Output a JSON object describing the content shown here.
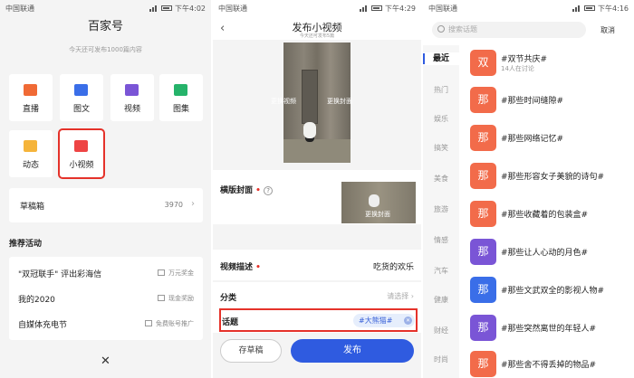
{
  "panel1": {
    "status": {
      "carrier": "中国联通",
      "time": "下午4:02"
    },
    "title": "百家号",
    "subtitle": "今天还可发布1000篇内容",
    "tiles": [
      {
        "label": "直播",
        "icon": "live-camera-icon",
        "color": "#f06a35"
      },
      {
        "label": "图文",
        "icon": "document-icon",
        "color": "#3a6ee8"
      },
      {
        "label": "视频",
        "icon": "video-play-icon",
        "color": "#7a55d6"
      },
      {
        "label": "图集",
        "icon": "image-gallery-icon",
        "color": "#25b36a"
      },
      {
        "label": "动态",
        "icon": "chat-bubble-icon",
        "color": "#f5b43b"
      },
      {
        "label": "小视频",
        "icon": "short-video-icon",
        "color": "#ee4444"
      }
    ],
    "draft": {
      "label": "草稿箱",
      "count": "3970"
    },
    "recommended_title": "推荐活动",
    "activities": [
      {
        "title": "\"双冠联手\" 评出彩海信",
        "tag": "万元奖金"
      },
      {
        "title": "我的2020",
        "tag": "现金奖励"
      },
      {
        "title": "自媒体充电节",
        "tag": "免费账号推广"
      }
    ],
    "close": "✕"
  },
  "panel2": {
    "status": {
      "carrier": "中国联通",
      "time": "下午4:29"
    },
    "title": "发布小视频",
    "subtitle": "今天还可发布5篇",
    "replace_video": "更换视频",
    "replace_cover": "更换封面",
    "cover_label": "横版封面",
    "cover_replace": "更换封面",
    "desc_label": "视频描述",
    "desc_value": "吃货的欢乐",
    "category_label": "分类",
    "category_placeholder": "请选择",
    "topic_label": "话题",
    "topic_tag": "#大熊猫#",
    "save_draft": "存草稿",
    "publish": "发布"
  },
  "panel3": {
    "status": {
      "carrier": "中国联通",
      "time": "下午4:16"
    },
    "search_placeholder": "搜索话题",
    "cancel": "取消",
    "categories": [
      "最近",
      "热门",
      "娱乐",
      "搞笑",
      "美食",
      "旅游",
      "情感",
      "汽车",
      "健康",
      "财经",
      "时尚"
    ],
    "topics": [
      {
        "badge": "双",
        "title": "#双节共庆#",
        "sub": "14人在讨论",
        "color": "#f26b4a"
      },
      {
        "badge": "那",
        "title": "#那些时间缝隙#",
        "sub": "",
        "color": "#f26b4a"
      },
      {
        "badge": "那",
        "title": "#那些网络记忆#",
        "sub": "",
        "color": "#f26b4a"
      },
      {
        "badge": "那",
        "title": "#那些形容女子美貌的诗句#",
        "sub": "",
        "color": "#f26b4a"
      },
      {
        "badge": "那",
        "title": "#那些收藏着的包装盒#",
        "sub": "",
        "color": "#f26b4a"
      },
      {
        "badge": "那",
        "title": "#那些让人心动的月色#",
        "sub": "",
        "color": "#7a55d6"
      },
      {
        "badge": "那",
        "title": "#那些文武双全的影视人物#",
        "sub": "",
        "color": "#3a6ee8"
      },
      {
        "badge": "那",
        "title": "#那些突然离世的年轻人#",
        "sub": "",
        "color": "#7a55d6"
      },
      {
        "badge": "那",
        "title": "#那些舍不得丢掉的物品#",
        "sub": "",
        "color": "#f26b4a"
      }
    ]
  }
}
